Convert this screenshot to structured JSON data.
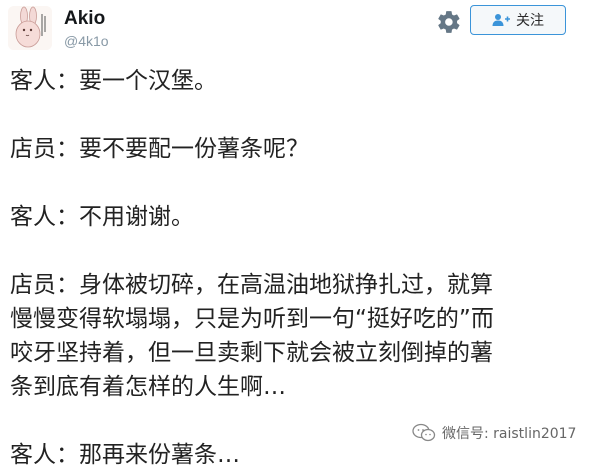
{
  "user": {
    "name": "Akio",
    "handle": "@4k1o"
  },
  "follow_button": {
    "label": "关注"
  },
  "tweet": {
    "lines": [
      "客人：要一个汉堡。",
      "",
      "店员：要不要配一份薯条呢？",
      "",
      "客人：不用谢谢。",
      "",
      "店员：身体被切碎，在高温油地狱挣扎过，就算",
      "慢慢变得软塌塌，只是为听到一句“挺好吃的”而",
      "咬牙坚持着，但一旦卖剩下就会被立刻倒掉的薯",
      "条到底有着怎样的人生啊…",
      "",
      "客人：那再来份薯条…"
    ]
  },
  "watermark": {
    "text": "微信号: raistlin2017"
  },
  "colors": {
    "follow_border": "#3b94d9",
    "handle": "#8899a6",
    "text": "#222222"
  }
}
